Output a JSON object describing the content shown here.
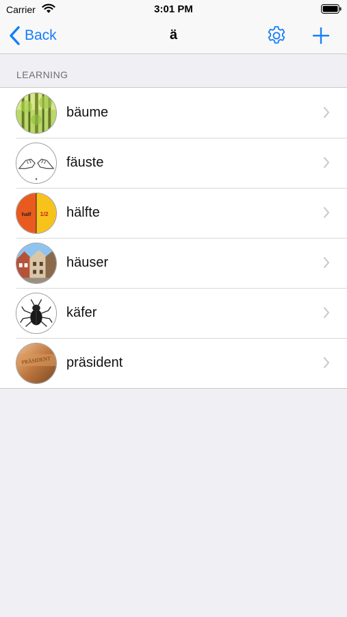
{
  "status_bar": {
    "carrier": "Carrier",
    "time": "3:01 PM",
    "icons": [
      "wifi-icon",
      "battery-icon"
    ]
  },
  "nav": {
    "back_label": "Back",
    "title": "ä",
    "icons": [
      "chevron-left-icon",
      "gear-icon",
      "plus-icon"
    ],
    "accent_color": "#147efb"
  },
  "section": {
    "header": "LEARNING"
  },
  "items": [
    {
      "label": "bäume",
      "thumbnail": "trees-photo"
    },
    {
      "label": "fäuste",
      "thumbnail": "fists-drawing"
    },
    {
      "label": "hälfte",
      "thumbnail": "half-fraction-graphic",
      "thumbnail_text": "half",
      "thumbnail_fraction": "1/2"
    },
    {
      "label": "häuser",
      "thumbnail": "houses-photo"
    },
    {
      "label": "käfer",
      "thumbnail": "beetle-drawing"
    },
    {
      "label": "präsident",
      "thumbnail": "president-plaque-photo",
      "thumbnail_text": "PRÄSIDENT"
    }
  ]
}
